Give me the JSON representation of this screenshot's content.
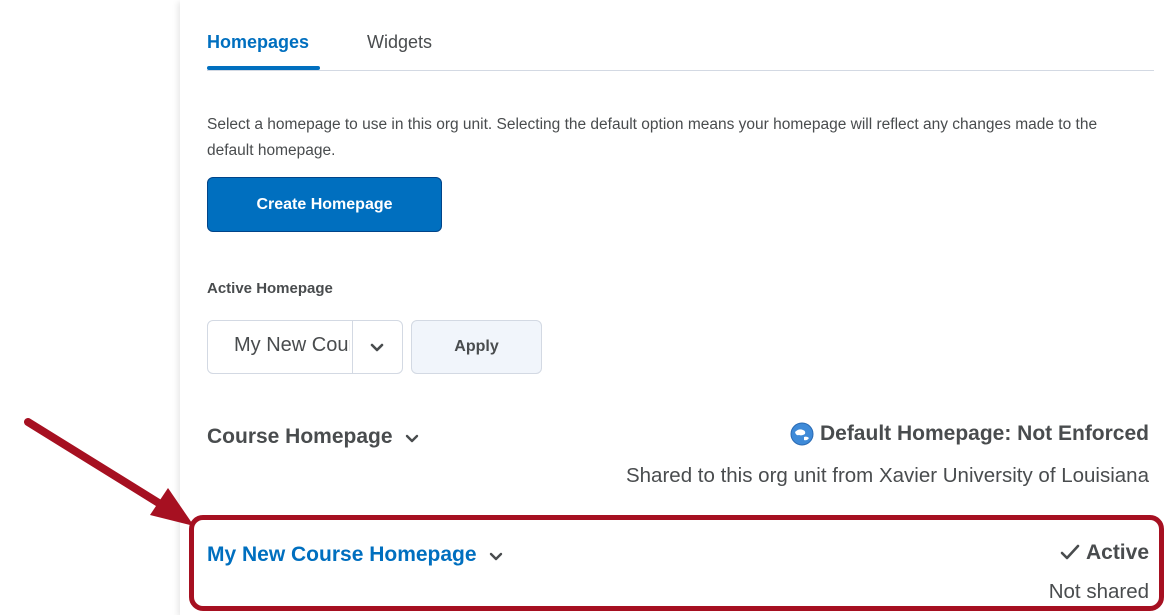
{
  "tabs": [
    {
      "label": "Homepages",
      "active": true
    },
    {
      "label": "Widgets",
      "active": false
    }
  ],
  "description": "Select a homepage to use in this org unit. Selecting the default option means your homepage will reflect any changes made to the default homepage.",
  "create_button": "Create Homepage",
  "active_homepage": {
    "label": "Active Homepage",
    "selected_value": "My New Course Homepage",
    "apply_button": "Apply"
  },
  "homepages": [
    {
      "name": "Course Homepage",
      "status": "Default Homepage: Not Enforced",
      "status_icon": "globe-icon",
      "sharing": "Shared to this org unit from Xavier University of Louisiana"
    },
    {
      "name": "My New Course Homepage",
      "status": "Active",
      "status_icon": "checkmark-icon",
      "sharing": "Not shared"
    }
  ],
  "colors": {
    "accent": "#006fbf",
    "annotation": "#a61021",
    "text": "#494c4e"
  }
}
